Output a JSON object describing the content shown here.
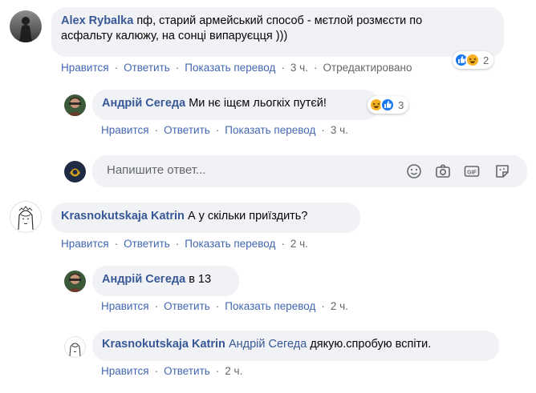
{
  "comments": [
    {
      "author": "Alex Rybalka",
      "text_line1": "пф, старий армейський способ - мєтлой розмєсти по",
      "text_line2": "асфальту калюжу, на сонці випаруєцця )))",
      "actions": {
        "like": "Нравится",
        "reply": "Ответить",
        "translate": "Показать перевод",
        "time": "3 ч.",
        "edited": "Отредактировано"
      },
      "reactions": {
        "count": "2",
        "types": [
          "like",
          "haha"
        ]
      }
    },
    {
      "author": "Андрій Сегеда",
      "text": "Ми нє іщєм льогкіх путєй!",
      "actions": {
        "like": "Нравится",
        "reply": "Ответить",
        "translate": "Показать перевод",
        "time": "3 ч."
      },
      "reactions": {
        "count": "3",
        "types": [
          "haha",
          "like"
        ]
      }
    },
    {
      "author": "Krasnokutskaja Katrin",
      "text": "А у скільки приїздить?",
      "actions": {
        "like": "Нравится",
        "reply": "Ответить",
        "translate": "Показать перевод",
        "time": "2 ч."
      }
    },
    {
      "author": "Андрій Сегеда",
      "text": "в 13",
      "actions": {
        "like": "Нравится",
        "reply": "Ответить",
        "translate": "Показать перевод",
        "time": "2 ч."
      }
    },
    {
      "author": "Krasnokutskaja Katrin",
      "mention": "Андрій Сегеда",
      "text": "дякую.спробую вспіти.",
      "actions": {
        "like": "Нравится",
        "reply": "Ответить",
        "time": "2 ч."
      }
    }
  ],
  "reply_box": {
    "placeholder": "Напишите ответ...",
    "tools": [
      "emoji-icon",
      "camera-icon",
      "gif-icon",
      "sticker-icon"
    ]
  },
  "colors": {
    "link": "#385898",
    "action": "#4267b2",
    "muted": "#65676b",
    "bubble": "#f0f2f5",
    "like": "#1877f2",
    "haha": "#f7b125"
  }
}
